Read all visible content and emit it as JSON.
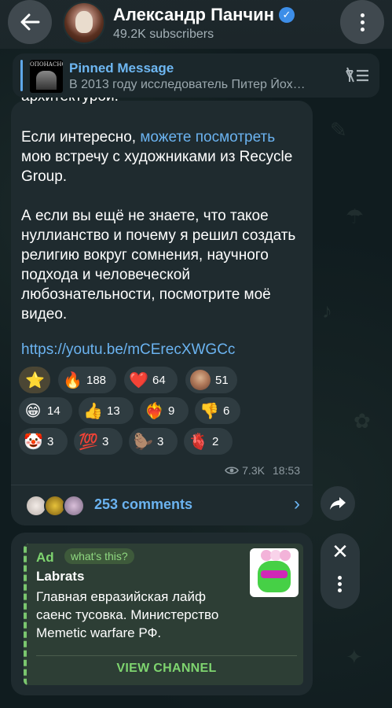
{
  "header": {
    "back_icon": "arrow-left-icon",
    "title": "Александр Панчин",
    "verified_icon": "verified-badge-icon",
    "subscribers": "49.2K subscribers",
    "menu_icon": "more-vertical-icon"
  },
  "pinned": {
    "label": "Pinned Message",
    "text": "В 2013 году исследователь Питер Йох…",
    "thumb_title": "ОПОНАСНО",
    "unpin_icon": "unpin-list-icon"
  },
  "message": {
    "cut_text": "архитектурой.",
    "para1_before": "Если интересно, ",
    "para1_link": "можете посмотреть",
    "para1_after": " мою встречу с художниками из Recycle Group.",
    "para2": "А если вы ещё не знаете, что такое нуллианство и почему я решил создать религию вокруг сомнения, научного подхода и человеческой любознательности, посмотрите моё видео.",
    "url": "https://youtu.be/mCErecXWGCc",
    "views": "7.3K",
    "time": "18:53",
    "views_icon": "eye-icon"
  },
  "reactions": [
    {
      "emoji": "⭐",
      "count": "",
      "name": "star"
    },
    {
      "emoji": "🔥",
      "count": "188",
      "name": "fire"
    },
    {
      "emoji": "❤️",
      "count": "64",
      "name": "heart"
    },
    {
      "emoji": "",
      "count": "51",
      "name": "custom-avatar"
    },
    {
      "emoji": "😁",
      "count": "14",
      "name": "grin"
    },
    {
      "emoji": "👍",
      "count": "13",
      "name": "thumbs-up"
    },
    {
      "emoji": "❤️‍🔥",
      "count": "9",
      "name": "heart-on-fire"
    },
    {
      "emoji": "👎",
      "count": "6",
      "name": "thumbs-down"
    },
    {
      "emoji": "🤡",
      "count": "3",
      "name": "clown"
    },
    {
      "emoji": "💯",
      "count": "3",
      "name": "hundred"
    },
    {
      "emoji": "🦫",
      "count": "3",
      "name": "beaver"
    },
    {
      "emoji": "🫀",
      "count": "2",
      "name": "anatomical-heart"
    }
  ],
  "comments": {
    "label": "253 comments",
    "chevron_icon": "chevron-right-icon"
  },
  "share_icon": "share-forward-icon",
  "ad": {
    "label": "Ad",
    "whats_this": "what's this?",
    "title": "Labrats",
    "text": "Главная евразийская лайф саенс тусовка. Министерство Memetic warfare РФ.",
    "button": "VIEW CHANNEL",
    "close_icon": "close-icon",
    "more_icon": "more-vertical-icon"
  },
  "colors": {
    "accent": "#6bb3f0",
    "ad_green": "#7ed46f",
    "bubble": "#1f2b2f"
  }
}
